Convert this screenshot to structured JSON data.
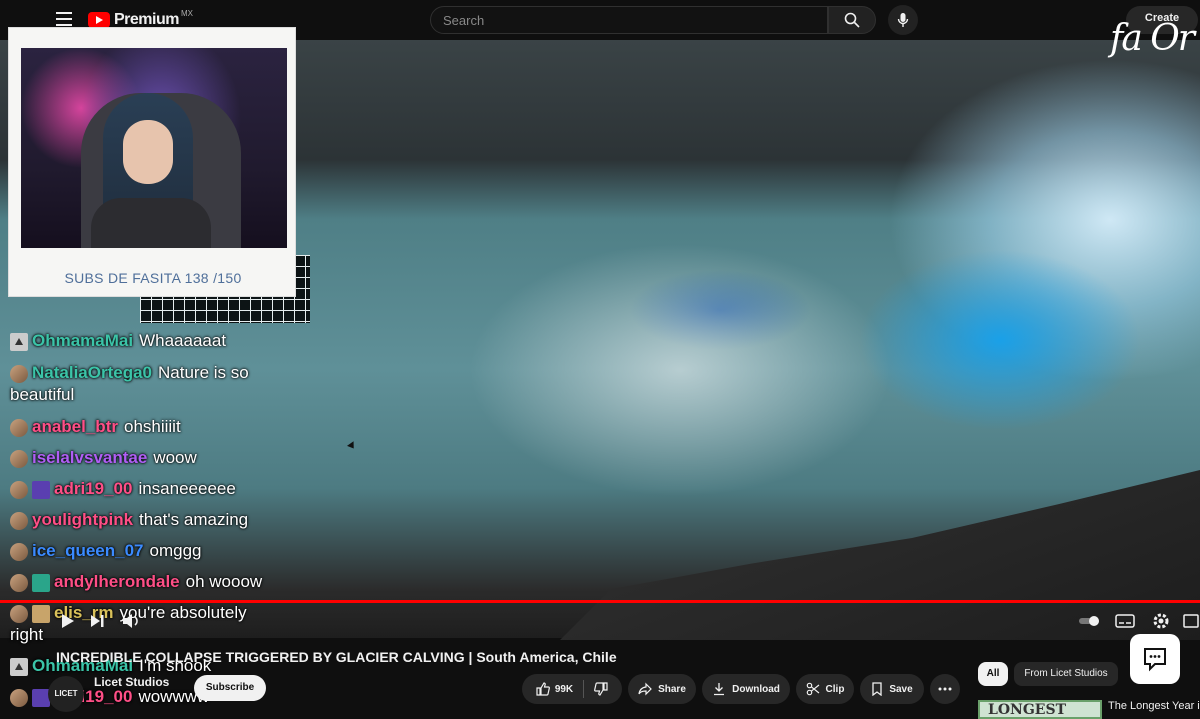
{
  "header": {
    "brand": "Premium",
    "region": "MX",
    "search_placeholder": "Search",
    "create_label": "Create",
    "signature": "fa Or"
  },
  "overlay": {
    "subs_goal": "SUBS DE FASITA 138 /150"
  },
  "chat": [
    {
      "user": "OhmamaMai",
      "user_color": "#3bc4a8",
      "text": "Whaaaaaat",
      "badges": [
        "mod"
      ]
    },
    {
      "user": "NataliaOrtega0",
      "user_color": "#3bc4a8",
      "text": "Nature is so",
      "text2": "beautiful",
      "badges": [
        "av"
      ]
    },
    {
      "user": "anabel_btr",
      "user_color": "#ff4f87",
      "text": "ohshiiiit",
      "badges": [
        "av"
      ]
    },
    {
      "user": "iselalvsvantae",
      "user_color": "#b05ef5",
      "text": "woow",
      "badges": [
        "av"
      ]
    },
    {
      "user": "adri19_00",
      "user_color": "#ff4f87",
      "text": "insaneeeeee",
      "badges": [
        "av",
        "num"
      ]
    },
    {
      "user": "youlightpink",
      "user_color": "#ff4f87",
      "text": "that's amazing",
      "badges": [
        "av"
      ]
    },
    {
      "user": "ice_queen_07",
      "user_color": "#3b8bff",
      "text": "omggg",
      "badges": [
        "av"
      ]
    },
    {
      "user": "andylherondale",
      "user_color": "#ff4f87",
      "text": "oh wooow",
      "badges": [
        "av",
        "gift"
      ]
    },
    {
      "user": "elis_rm",
      "user_color": "#d9c15a",
      "text": "you're absolutely",
      "text2": "right",
      "badges": [
        "av",
        "sub"
      ]
    },
    {
      "user": "OhmamaMai",
      "user_color": "#3bc4a8",
      "text": "I'm shook",
      "badges": [
        "mod"
      ]
    },
    {
      "user": "adri19_00",
      "user_color": "#ff4f87",
      "text": "wowwww",
      "badges": [
        "av",
        "num"
      ]
    }
  ],
  "player": {
    "progress": 1.0
  },
  "video": {
    "title": "INCREDIBLE COLLAPSE TRIGGERED BY GLACIER CALVING | South America, Chile"
  },
  "channel": {
    "avatar_text": "LICET",
    "name": "Licet Studios",
    "subscribe_label": "Subscribe"
  },
  "actions": {
    "like_count": "99K",
    "share": "Share",
    "download": "Download",
    "clip": "Clip",
    "save": "Save"
  },
  "chips": {
    "all": "All",
    "from_channel": "From Licet Studios"
  },
  "up_next": {
    "thumb_text": "LONGEST",
    "title": "The Longest Year in"
  }
}
